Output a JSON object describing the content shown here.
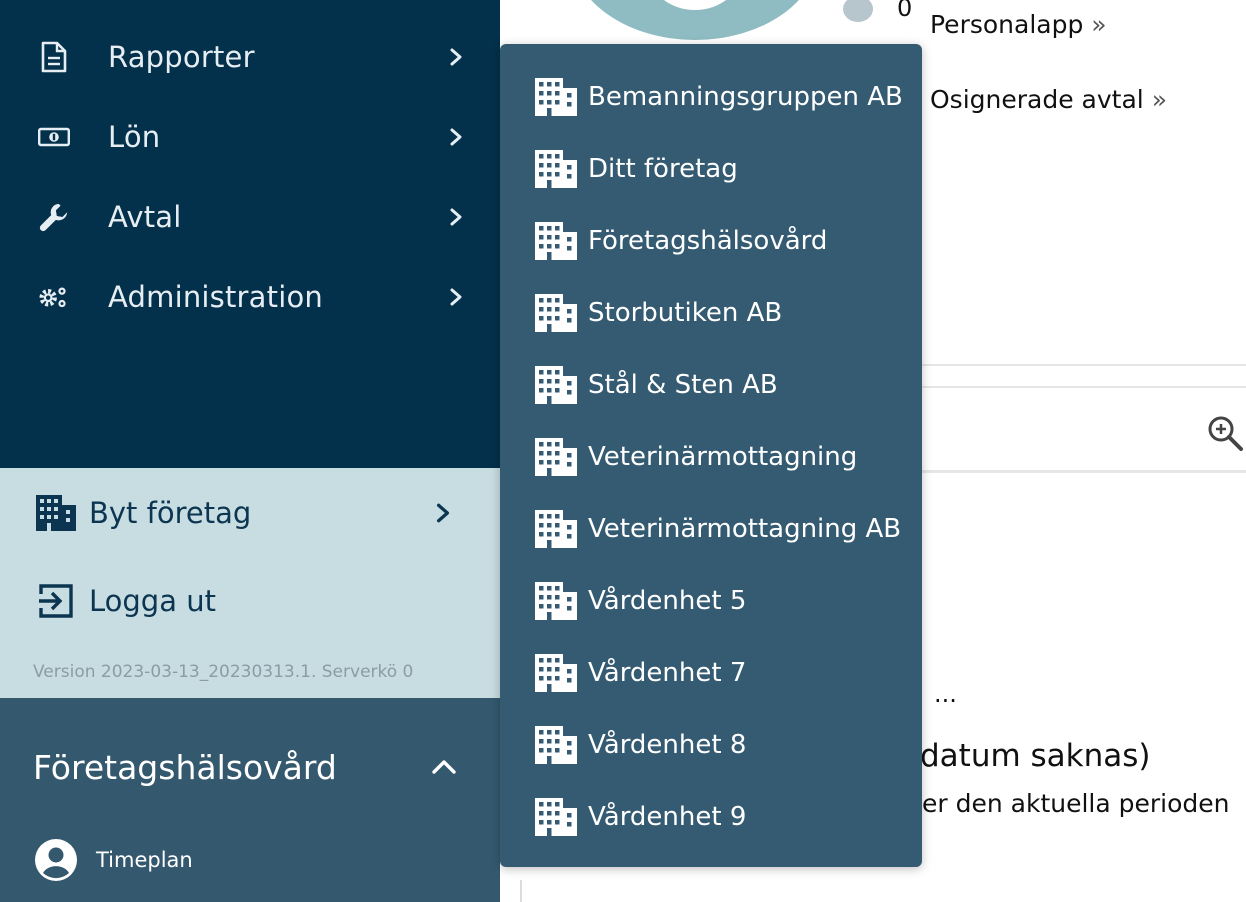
{
  "sidebar": {
    "nav": [
      {
        "label": "Rapporter",
        "icon": "document-icon"
      },
      {
        "label": "Lön",
        "icon": "money-icon"
      },
      {
        "label": "Avtal",
        "icon": "wrench-icon"
      },
      {
        "label": "Administration",
        "icon": "gears-icon"
      }
    ],
    "switch_company": "Byt företag",
    "logout": "Logga ut",
    "version": "Version 2023-03-13_20230313.1. Serverkö 0",
    "current_company": "Företagshälsovård",
    "user": "Timeplan"
  },
  "content": {
    "count": "0",
    "link1": "Personalapp",
    "link2": "Osignerade avtal",
    "frag1": "...",
    "frag2": "datum saknas)",
    "frag3": "er den aktuella perioden"
  },
  "dropdown": {
    "companies": [
      "Bemanningsgruppen AB",
      "Ditt företag",
      "Företagshälsovård",
      "Storbutiken AB",
      "Stål & Sten AB",
      "Veterinärmottagning",
      "Veterinärmottagning AB",
      "Vårdenhet 5",
      "Vårdenhet 7",
      "Vårdenhet 8",
      "Vårdenhet 9"
    ]
  },
  "colors": {
    "sidebar": "#03304a",
    "light_panel": "#c8dde1",
    "company_panel": "#34596f",
    "dropdown": "#355b72"
  }
}
